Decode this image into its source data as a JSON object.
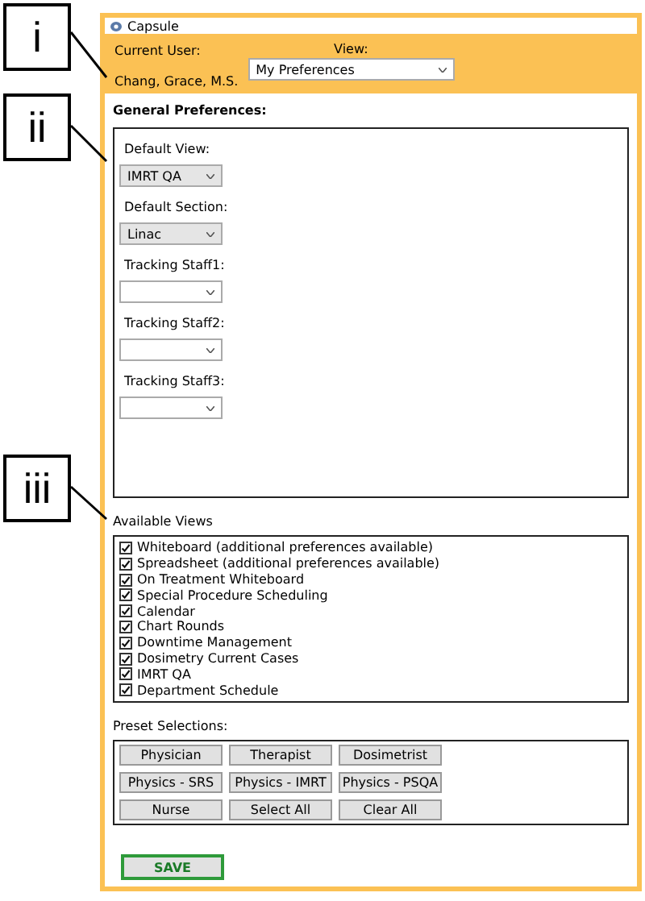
{
  "callouts": [
    "i",
    "ii",
    "iii"
  ],
  "window": {
    "title": "Capsule"
  },
  "header": {
    "user_label": "Current User:",
    "user_name": "Chang, Grace, M.S.",
    "view_label": "View:",
    "view_value": "My Preferences"
  },
  "general": {
    "title": "General Preferences:",
    "fields": [
      {
        "label": "Default View:",
        "value": "IMRT QA",
        "disabled": true
      },
      {
        "label": "Default Section:",
        "value": "Linac",
        "disabled": true
      },
      {
        "label": "Tracking Staff1:",
        "disabled": false
      },
      {
        "label": "Tracking Staff2:",
        "disabled": false
      },
      {
        "label": "Tracking Staff3:",
        "disabled": false
      }
    ]
  },
  "available_views": {
    "title": "Available Views",
    "items": [
      {
        "label": "Whiteboard (additional preferences available)",
        "checked": true
      },
      {
        "label": "Spreadsheet (additional preferences available)",
        "checked": true
      },
      {
        "label": "On Treatment Whiteboard",
        "checked": true
      },
      {
        "label": "Special Procedure Scheduling",
        "checked": true
      },
      {
        "label": "Calendar",
        "checked": true
      },
      {
        "label": "Chart Rounds",
        "checked": true
      },
      {
        "label": "Downtime Management",
        "checked": true
      },
      {
        "label": "Dosimetry Current Cases",
        "checked": true
      },
      {
        "label": "IMRT QA",
        "checked": true
      },
      {
        "label": "Department Schedule",
        "checked": true
      }
    ]
  },
  "presets": {
    "title": "Preset Selections:",
    "buttons": [
      "Physician",
      "Therapist",
      "Dosimetrist",
      "Physics - SRS",
      "Physics - IMRT",
      "Physics - PSQA",
      "Nurse",
      "Select All",
      "Clear All"
    ]
  },
  "save_button": "SAVE"
}
